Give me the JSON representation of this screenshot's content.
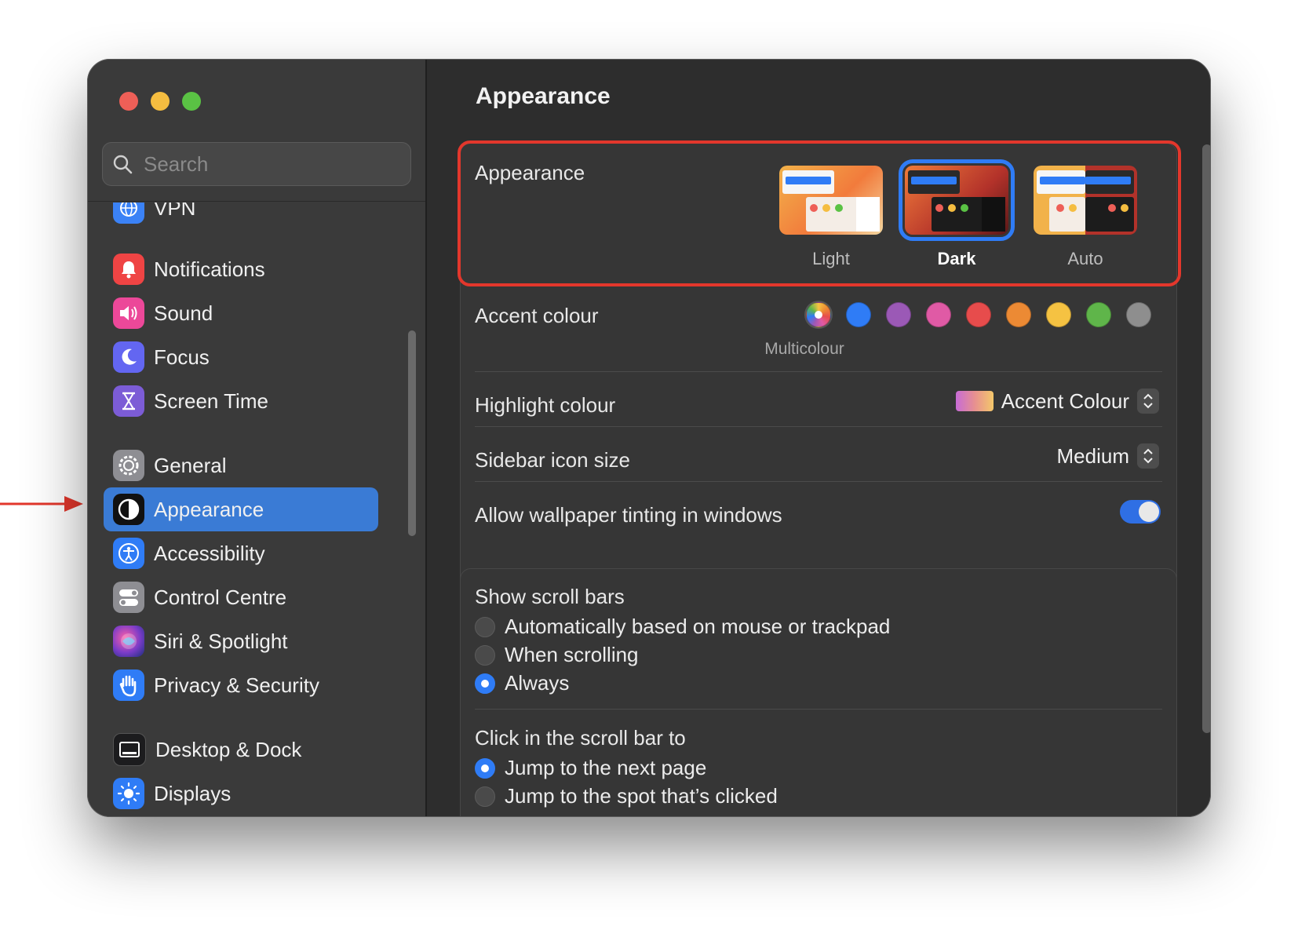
{
  "sidebar": {
    "search_placeholder": "Search",
    "items": [
      {
        "label": "VPN",
        "icon": "vpn-globe-icon",
        "color": "#3b82f6"
      },
      {
        "label": "Notifications",
        "icon": "bell-icon",
        "color": "#ef4444"
      },
      {
        "label": "Sound",
        "icon": "speaker-icon",
        "color": "#ec4899"
      },
      {
        "label": "Focus",
        "icon": "moon-icon",
        "color": "#6366f1"
      },
      {
        "label": "Screen Time",
        "icon": "hourglass-icon",
        "color": "#7c5cd6"
      },
      {
        "label": "General",
        "icon": "gear-icon",
        "color": "#8e8e93"
      },
      {
        "label": "Appearance",
        "icon": "appearance-icon",
        "color": "#111111"
      },
      {
        "label": "Accessibility",
        "icon": "accessibility-icon",
        "color": "#2f7cf6"
      },
      {
        "label": "Control Centre",
        "icon": "toggles-icon",
        "color": "#8e8e93"
      },
      {
        "label": "Siri & Spotlight",
        "icon": "siri-icon",
        "color": "#7a3cc8"
      },
      {
        "label": "Privacy & Security",
        "icon": "hand-icon",
        "color": "#2f7cf6"
      },
      {
        "label": "Desktop & Dock",
        "icon": "dock-icon",
        "color": "#1c1c1e"
      },
      {
        "label": "Displays",
        "icon": "sun-icon",
        "color": "#2f7cf6"
      }
    ],
    "selected": "Appearance"
  },
  "main": {
    "title": "Appearance",
    "appearance": {
      "label": "Appearance",
      "options": [
        {
          "label": "Light",
          "selected": false
        },
        {
          "label": "Dark",
          "selected": true
        },
        {
          "label": "Auto",
          "selected": false
        }
      ]
    },
    "accent": {
      "label": "Accent colour",
      "caption": "Multicolour",
      "colors": [
        "multicolour",
        "#2f7cf6",
        "#9b59b6",
        "#e05aa5",
        "#e74c4c",
        "#ec8a34",
        "#f5c242",
        "#5fb54a",
        "#8e8e8e"
      ]
    },
    "highlight": {
      "label": "Highlight colour",
      "value": "Accent Colour"
    },
    "sidebar_icon_size": {
      "label": "Sidebar icon size",
      "value": "Medium"
    },
    "wallpaper_tinting": {
      "label": "Allow wallpaper tinting in windows",
      "enabled": true
    },
    "scroll_bars": {
      "label": "Show scroll bars",
      "options": [
        {
          "label": "Automatically based on mouse or trackpad",
          "selected": false
        },
        {
          "label": "When scrolling",
          "selected": false
        },
        {
          "label": "Always",
          "selected": true
        }
      ]
    },
    "click_scroll_bar": {
      "label": "Click in the scroll bar to",
      "options": [
        {
          "label": "Jump to the next page",
          "selected": true
        },
        {
          "label": "Jump to the spot that’s clicked",
          "selected": false
        }
      ]
    }
  },
  "colors": {
    "selection_blue": "#3a7bd5",
    "annotation_red": "#e3372c"
  }
}
